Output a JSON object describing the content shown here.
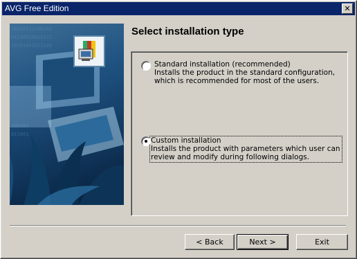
{
  "window": {
    "title": "AVG Free Edition"
  },
  "heading": "Select installation type",
  "options": [
    {
      "title": "Standard installation (recommended)",
      "desc_line1": "Installs the product in the standard configuration,",
      "desc_line2": "which is recommended for most of the users.",
      "selected": false
    },
    {
      "title": "Custom installation",
      "desc_line1": "Installs the product with parameters which user can",
      "desc_line2": "review and modify during following dialogs.",
      "selected": true
    }
  ],
  "buttons": {
    "back": "< Back",
    "next": "Next >",
    "exit": "Exit"
  },
  "icons": {
    "close": "close-icon",
    "installer": "avg-installer-icon"
  }
}
